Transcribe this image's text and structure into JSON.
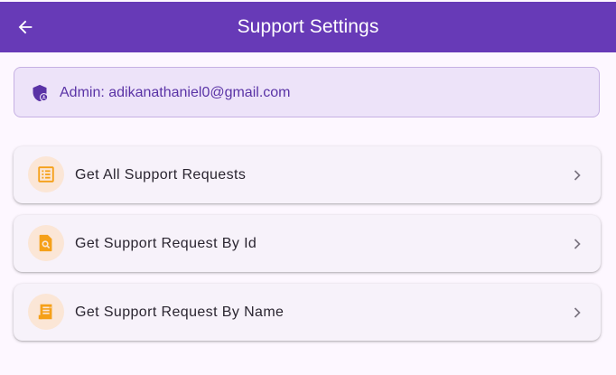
{
  "app_bar": {
    "title": "Support Settings",
    "back_icon": "arrow-left-icon",
    "color": "#673ab7"
  },
  "admin": {
    "label": "Admin: adikanathaniel0@gmail.com",
    "icon": "admin-shield-icon"
  },
  "menu": {
    "items": [
      {
        "label": "Get All Support Requests",
        "icon": "list-alt-icon"
      },
      {
        "label": "Get Support Request By Id",
        "icon": "find-in-page-icon"
      },
      {
        "label": "Get Support Request By Name",
        "icon": "receipt-long-icon"
      }
    ],
    "chevron_icon": "chevron-right-icon",
    "icon_color": "#f5a018"
  }
}
